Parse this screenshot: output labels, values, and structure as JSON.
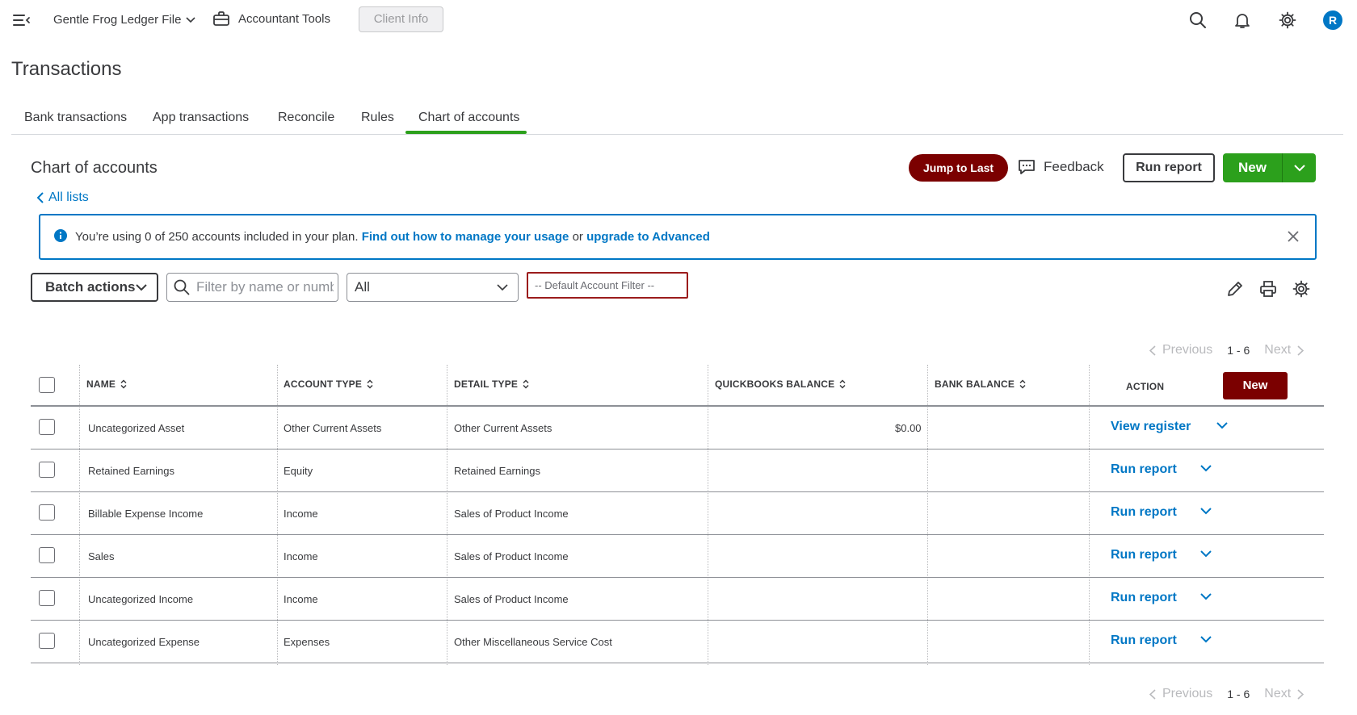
{
  "topbar": {
    "company_name": "Gentle Frog Ledger File",
    "accountant_tools": "Accountant Tools",
    "client_info": "Client Info",
    "avatar_initial": "R"
  },
  "page_title": "Transactions",
  "tabs": [
    {
      "label": "Bank transactions"
    },
    {
      "label": "App transactions"
    },
    {
      "label": "Reconcile"
    },
    {
      "label": "Rules"
    },
    {
      "label": "Chart of accounts",
      "active": true
    }
  ],
  "section": {
    "title": "Chart of accounts",
    "all_lists": "All lists",
    "jump_to_last": "Jump to Last",
    "feedback": "Feedback",
    "run_report": "Run report",
    "new": "New"
  },
  "banner": {
    "text_before": "You’re using 0 of 250 accounts included in your plan.",
    "link1": "Find out how to manage your usage",
    "text_middle": "or",
    "link2": "upgrade to Advanced"
  },
  "filters": {
    "batch_actions": "Batch actions",
    "search_placeholder": "Filter by name or number",
    "type_filter": "All",
    "default_filter": "-- Default Account Filter --"
  },
  "pagination": {
    "previous": "Previous",
    "range": "1 - 6",
    "next": "Next"
  },
  "table": {
    "columns": {
      "name": "NAME",
      "account_type": "ACCOUNT TYPE",
      "detail_type": "DETAIL TYPE",
      "qb_balance": "QUICKBOOKS BALANCE",
      "bank_balance": "BANK BALANCE",
      "action": "ACTION"
    },
    "new_button": "New",
    "rows": [
      {
        "name": "Uncategorized Asset",
        "account_type": "Other Current Assets",
        "detail_type": "Other Current Assets",
        "qb_balance": "$0.00",
        "bank_balance": "",
        "action": "View register"
      },
      {
        "name": "Retained Earnings",
        "account_type": "Equity",
        "detail_type": "Retained Earnings",
        "qb_balance": "",
        "bank_balance": "",
        "action": "Run report"
      },
      {
        "name": "Billable Expense Income",
        "account_type": "Income",
        "detail_type": "Sales of Product Income",
        "qb_balance": "",
        "bank_balance": "",
        "action": "Run report"
      },
      {
        "name": "Sales",
        "account_type": "Income",
        "detail_type": "Sales of Product Income",
        "qb_balance": "",
        "bank_balance": "",
        "action": "Run report"
      },
      {
        "name": "Uncategorized Income",
        "account_type": "Income",
        "detail_type": "Sales of Product Income",
        "qb_balance": "",
        "bank_balance": "",
        "action": "Run report"
      },
      {
        "name": "Uncategorized Expense",
        "account_type": "Expenses",
        "detail_type": "Other Miscellaneous Service Cost",
        "qb_balance": "",
        "bank_balance": "",
        "action": "Run report"
      }
    ]
  },
  "colors": {
    "primary_green": "#2ca01c",
    "link_blue": "#0077c5",
    "dark_red": "#7b0000",
    "text": "#393a3d"
  }
}
